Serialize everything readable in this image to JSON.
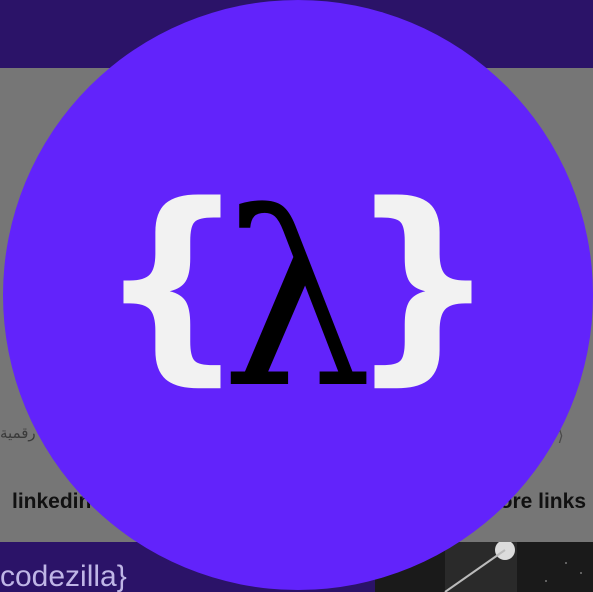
{
  "avatar": {
    "background_color": "#6223fb",
    "logo": {
      "left_brace": "{",
      "symbol": "λ",
      "right_brace": "}",
      "brace_color": "#f2f2f2",
      "symbol_color": "#000000"
    }
  },
  "background": {
    "arabic_snippet": "رقمية",
    "arabic_icon": "ا ⟩",
    "link_left": "linkedin",
    "link_right": "more links",
    "bottom_brand_text": "codezilla}"
  },
  "colors": {
    "banner": "#2b1368",
    "overlay": "#767676"
  }
}
